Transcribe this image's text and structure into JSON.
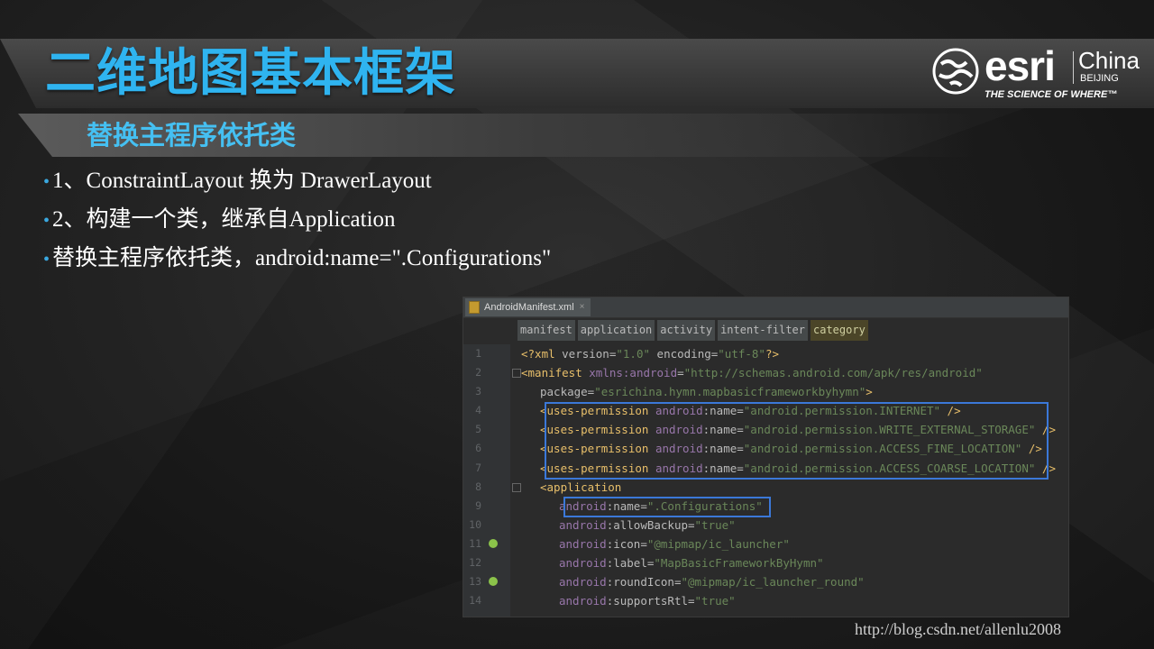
{
  "slide": {
    "title": "二维地图基本框架",
    "subtitle": "替换主程序依托类",
    "bullets": [
      "1、ConstraintLayout  换为 DrawerLayout",
      "2、构建一个类，继承自Application",
      "替换主程序依托类，android:name=\".Configurations\""
    ]
  },
  "logo": {
    "brand": "esri",
    "region": "China",
    "city": "BEIJING",
    "tagline": "THE SCIENCE OF WHERE™"
  },
  "ide": {
    "file_tab": "AndroidManifest.xml",
    "file_close": "×",
    "breadcrumbs": [
      "manifest",
      "application",
      "activity",
      "intent-filter",
      "category"
    ],
    "lines": [
      {
        "num": "1",
        "indent": 0,
        "parts": [
          [
            "tag",
            "<?xml "
          ],
          [
            "attr",
            "version="
          ],
          [
            "str",
            "\"1.0\""
          ],
          [
            "attr",
            " encoding="
          ],
          [
            "str",
            "\"utf-8\""
          ],
          [
            "tag",
            "?>"
          ]
        ]
      },
      {
        "num": "2",
        "indent": 0,
        "parts": [
          [
            "tag",
            "<manifest "
          ],
          [
            "ns",
            "xmlns:android"
          ],
          [
            "attr",
            "="
          ],
          [
            "str",
            "\"http://schemas.android.com/apk/res/android\""
          ]
        ]
      },
      {
        "num": "3",
        "indent": 3,
        "parts": [
          [
            "attr",
            "package="
          ],
          [
            "str",
            "\"esrichina.hymn.mapbasicframeworkbyhymn\""
          ],
          [
            "tag",
            ">"
          ]
        ]
      },
      {
        "num": "4",
        "indent": 3,
        "parts": [
          [
            "tag",
            "<uses-permission "
          ],
          [
            "ns",
            "android"
          ],
          [
            "attr",
            ":name="
          ],
          [
            "str",
            "\"android.permission.INTERNET\""
          ],
          [
            "tag",
            " />"
          ]
        ]
      },
      {
        "num": "5",
        "indent": 3,
        "parts": [
          [
            "tag",
            "<uses-permission "
          ],
          [
            "ns",
            "android"
          ],
          [
            "attr",
            ":name="
          ],
          [
            "str",
            "\"android.permission.WRITE_EXTERNAL_STORAGE\""
          ],
          [
            "tag",
            " />"
          ]
        ]
      },
      {
        "num": "6",
        "indent": 3,
        "parts": [
          [
            "tag",
            "<uses-permission "
          ],
          [
            "ns",
            "android"
          ],
          [
            "attr",
            ":name="
          ],
          [
            "str",
            "\"android.permission.ACCESS_FINE_LOCATION\""
          ],
          [
            "tag",
            " />"
          ]
        ]
      },
      {
        "num": "7",
        "indent": 3,
        "parts": [
          [
            "tag",
            "<uses-permission "
          ],
          [
            "ns",
            "android"
          ],
          [
            "attr",
            ":name="
          ],
          [
            "str",
            "\"android.permission.ACCESS_COARSE_LOCATION\""
          ],
          [
            "tag",
            " />"
          ]
        ]
      },
      {
        "num": "8",
        "indent": 3,
        "parts": [
          [
            "tag",
            "<application"
          ]
        ]
      },
      {
        "num": "9",
        "indent": 6,
        "parts": [
          [
            "ns",
            "android"
          ],
          [
            "attr",
            ":name="
          ],
          [
            "str",
            "\".Configurations\""
          ]
        ]
      },
      {
        "num": "10",
        "indent": 6,
        "parts": [
          [
            "ns",
            "android"
          ],
          [
            "attr",
            ":allowBackup="
          ],
          [
            "str",
            "\"true\""
          ]
        ]
      },
      {
        "num": "11",
        "indent": 6,
        "parts": [
          [
            "ns",
            "android"
          ],
          [
            "attr",
            ":icon="
          ],
          [
            "str",
            "\"@mipmap/ic_launcher\""
          ]
        ]
      },
      {
        "num": "12",
        "indent": 6,
        "parts": [
          [
            "ns",
            "android"
          ],
          [
            "attr",
            ":label="
          ],
          [
            "str",
            "\"MapBasicFrameworkByHymn\""
          ]
        ]
      },
      {
        "num": "13",
        "indent": 6,
        "parts": [
          [
            "ns",
            "android"
          ],
          [
            "attr",
            ":roundIcon="
          ],
          [
            "str",
            "\"@mipmap/ic_launcher_round\""
          ]
        ]
      },
      {
        "num": "14",
        "indent": 6,
        "parts": [
          [
            "ns",
            "android"
          ],
          [
            "attr",
            ":supportsRtl="
          ],
          [
            "str",
            "\"true\""
          ]
        ]
      }
    ]
  },
  "watermark": "http://blog.csdn.net/allenlu2008",
  "colors": {
    "title_blue": "#2fb4f0",
    "highlight_box": "#3b78d8"
  }
}
